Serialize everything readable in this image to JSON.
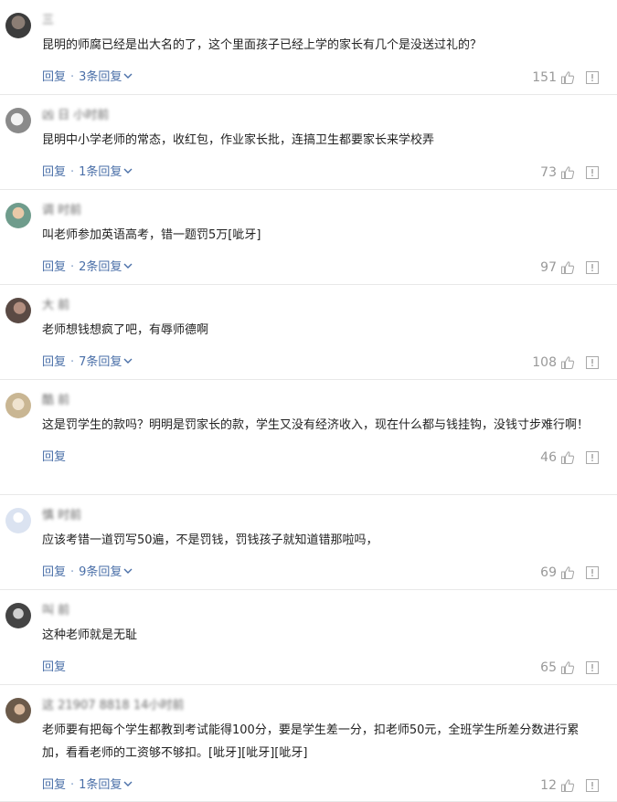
{
  "ui": {
    "reply_label": "回复"
  },
  "comments": [
    {
      "username": "三 ",
      "avatar_color": "#3c3c3c",
      "text": "昆明的师腐已经是出大名的了，这个里面孩子已经上学的家长有几个是没送过礼的？",
      "replies": "3条回复",
      "likes": "151"
    },
    {
      "username": "凶 日 小时前",
      "avatar_color": "#8a8a8a",
      "text": "昆明中小学老师的常态，收红包，作业家长批，连搞卫生都要家长来学校弄",
      "replies": "1条回复",
      "likes": "73"
    },
    {
      "username": "调 时前",
      "avatar_color": "#6f9c8c",
      "text": "叫老师参加英语高考，错一题罚5万[呲牙]",
      "replies": "2条回复",
      "likes": "97"
    },
    {
      "username": "大 前",
      "avatar_color": "#5a4a44",
      "text": "老师想钱想疯了吧，有辱师德啊",
      "replies": "7条回复",
      "likes": "108"
    },
    {
      "username": "酷 前",
      "avatar_color": "#c9b693",
      "text": "这是罚学生的款吗？明明是罚家长的款，学生又没有经济收入，现在什么都与钱挂钩，没钱寸步难行啊！",
      "replies": "",
      "likes": "46"
    },
    {
      "username": "慎 时前",
      "avatar_color": "#dbe3f1",
      "text": "应该考错一道罚写50遍，不是罚钱，罚钱孩子就知道错那啦吗，",
      "replies": "9条回复",
      "likes": "69"
    },
    {
      "username": "叫 前",
      "avatar_color": "#444444",
      "text": "这种老师就是无耻",
      "replies": "",
      "likes": "65"
    },
    {
      "username": "这 21907 8818 14小时前",
      "avatar_color": "#6b5a4a",
      "text": "老师要有把每个学生都教到考试能得100分，要是学生差一分，扣老师50元，全班学生所差分数进行累加，看看老师的工资够不够扣。[呲牙][呲牙][呲牙]",
      "replies": "1条回复",
      "likes": "12"
    }
  ]
}
